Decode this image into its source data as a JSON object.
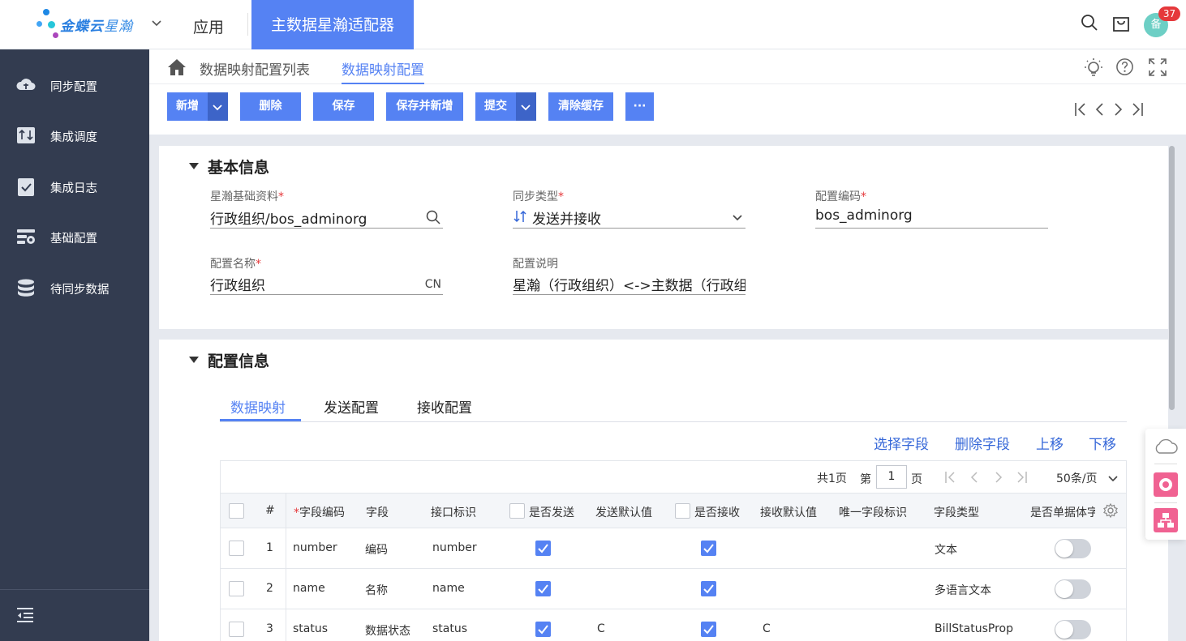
{
  "colors": {
    "primary": "#5582f3",
    "sidebar": "#333c50",
    "danger": "#e5383b",
    "link": "#3567d8"
  },
  "topbar": {
    "brand_main": "金蝶云",
    "brand_sub": "星瀚",
    "app_label": "应用",
    "active_app": "主数据星瀚适配器",
    "avatar_text": "备",
    "notification_count": "37",
    "icons": [
      "search-icon",
      "cart-icon",
      "avatar"
    ]
  },
  "sidebar": {
    "items": [
      {
        "label": "同步配置",
        "icon": "cloud-sync-icon"
      },
      {
        "label": "集成调度",
        "icon": "schedule-icon"
      },
      {
        "label": "集成日志",
        "icon": "log-icon"
      },
      {
        "label": "基础配置",
        "icon": "settings-icon"
      },
      {
        "label": "待同步数据",
        "icon": "database-icon"
      }
    ],
    "collapse_icon": "collapse-menu-icon"
  },
  "breadcrumb": {
    "home_icon": "home-icon",
    "items": [
      "数据映射配置列表",
      "数据映射配置"
    ]
  },
  "toolbar": {
    "new": "新增",
    "delete": "删除",
    "save": "保存",
    "save_new": "保存并新增",
    "submit": "提交",
    "clear_cache": "清除缓存",
    "more": "···"
  },
  "basic": {
    "title": "基本信息",
    "xh_label": "星瀚基础资料",
    "xh_value": "行政组织/bos_adminorg",
    "sync_label": "同步类型",
    "sync_value": "发送并接收",
    "code_label": "配置编码",
    "code_value": "bos_adminorg",
    "name_label": "配置名称",
    "name_value": "行政组织",
    "name_lang": "CN",
    "desc_label": "配置说明",
    "desc_value": "星瀚（行政组织）<->主数据（行政组"
  },
  "config": {
    "title": "配置信息",
    "tabs": [
      "数据映射",
      "发送配置",
      "接收配置"
    ],
    "active_tab": 0,
    "actions": [
      "选择字段",
      "删除字段",
      "上移",
      "下移"
    ]
  },
  "grid": {
    "total_pages": "共1页",
    "page_prefix": "第",
    "page_value": "1",
    "page_suffix": "页",
    "page_size": "50条/页",
    "headers": {
      "index": "#",
      "field_code": "字段编码",
      "field": "字段",
      "api_id": "接口标识",
      "is_send": "是否发送",
      "send_default": "发送默认值",
      "is_receive": "是否接收",
      "receive_default": "接收默认值",
      "unique_field": "唯一字段标识",
      "field_type": "字段类型",
      "is_single": "是否单据体字"
    },
    "rows": [
      {
        "index": "1",
        "code": "number",
        "field": "编码",
        "api": "number",
        "send": true,
        "send_default": "",
        "receive": true,
        "receive_default": "",
        "type": "文本",
        "single": false
      },
      {
        "index": "2",
        "code": "name",
        "field": "名称",
        "api": "name",
        "send": true,
        "send_default": "",
        "receive": true,
        "receive_default": "",
        "type": "多语言文本",
        "single": false
      },
      {
        "index": "3",
        "code": "status",
        "field": "数据状态",
        "api": "status",
        "send": true,
        "send_default": "C",
        "receive": true,
        "receive_default": "C",
        "type": "BillStatusProp",
        "single": false
      }
    ]
  }
}
